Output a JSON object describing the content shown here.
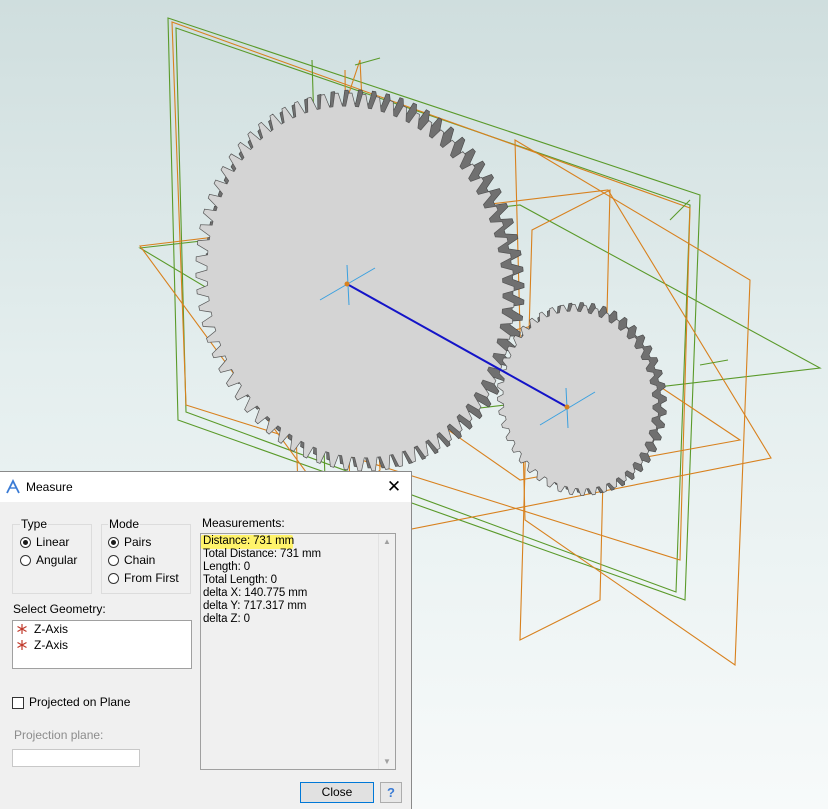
{
  "dialog": {
    "title": "Measure",
    "close_glyph": "✕",
    "type_group": {
      "label": "Type",
      "options": [
        {
          "label": "Linear",
          "selected": true
        },
        {
          "label": "Angular",
          "selected": false
        }
      ]
    },
    "mode_group": {
      "label": "Mode",
      "options": [
        {
          "label": "Pairs",
          "selected": true
        },
        {
          "label": "Chain",
          "selected": false
        },
        {
          "label": "From First",
          "selected": false
        }
      ]
    },
    "select_geometry": {
      "label": "Select Geometry:",
      "items": [
        {
          "label": "Z-Axis",
          "icon": "axis-icon"
        },
        {
          "label": "Z-Axis",
          "icon": "axis-icon"
        }
      ]
    },
    "projected_on_plane": {
      "label": "Projected on Plane",
      "checked": false
    },
    "projection_plane": {
      "label": "Projection plane:",
      "value": ""
    },
    "measurements": {
      "label": "Measurements:",
      "lines": [
        "Distance: 731 mm",
        "Total Distance: 731 mm",
        "Length:  0",
        "Total Length:  0",
        "delta X: 140.775 mm",
        "delta Y: 717.317 mm",
        "delta Z:  0"
      ],
      "highlight_color": "#fff36a"
    },
    "close_button": "Close",
    "help_button": "?"
  },
  "viewport": {
    "background_top": "#cfdede",
    "background_bottom": "#f7fafa",
    "colors": {
      "sketch_green": "#5a9a2a",
      "sketch_orange": "#d8811e",
      "gear_face": "#d4d4d4",
      "gear_tooth_side": "#707070",
      "measure_line": "#1414c8",
      "axis_cyan": "#3aa0e0"
    }
  }
}
